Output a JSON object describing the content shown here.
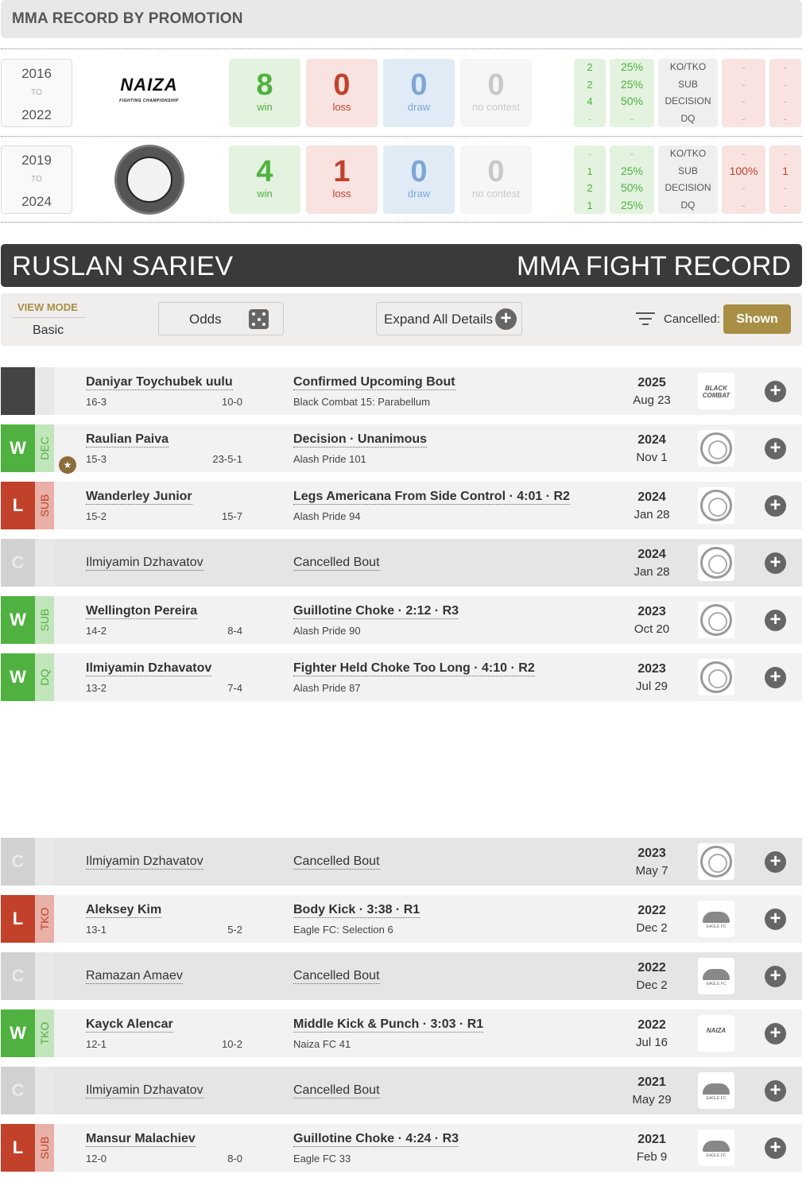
{
  "promotion_section": {
    "title": "MMA RECORD BY PROMOTION"
  },
  "promotions": [
    {
      "start": "2016",
      "to": "TO",
      "end": "2022",
      "logo": "naiza-fighting-championship-logo",
      "logo_text": "NAIZA",
      "logo_sub": "FIGHTING CHAMPIONSHIP",
      "win": "8",
      "loss": "0",
      "draw": "0",
      "nc": "0",
      "win_label": "win",
      "loss_label": "loss",
      "draw_label": "draw",
      "nc_label": "no contest",
      "methods": [
        {
          "count": "2",
          "pct": "25%",
          "name": "KO/TKO",
          "loss_pct": "-",
          "loss_count": "-"
        },
        {
          "count": "2",
          "pct": "25%",
          "name": "SUB",
          "loss_pct": "-",
          "loss_count": "-"
        },
        {
          "count": "4",
          "pct": "50%",
          "name": "DECISION",
          "loss_pct": "-",
          "loss_count": "-"
        },
        {
          "count": "-",
          "pct": "-",
          "name": "DQ",
          "loss_pct": "-",
          "loss_count": "-"
        }
      ]
    },
    {
      "start": "2019",
      "to": "TO",
      "end": "2024",
      "logo": "alash-pride-lion-logo",
      "win": "4",
      "loss": "1",
      "draw": "0",
      "nc": "0",
      "win_label": "win",
      "loss_label": "loss",
      "draw_label": "draw",
      "nc_label": "no contest",
      "methods": [
        {
          "count": "-",
          "pct": "-",
          "name": "KO/TKO",
          "loss_pct": "-",
          "loss_count": "-"
        },
        {
          "count": "1",
          "pct": "25%",
          "name": "SUB",
          "loss_pct": "100%",
          "loss_count": "1"
        },
        {
          "count": "2",
          "pct": "50%",
          "name": "DECISION",
          "loss_pct": "-",
          "loss_count": "-"
        },
        {
          "count": "1",
          "pct": "25%",
          "name": "DQ",
          "loss_pct": "-",
          "loss_count": "-"
        }
      ]
    }
  ],
  "fighter": {
    "name": "RUSLAN SARIEV",
    "title": "MMA FIGHT RECORD"
  },
  "controls": {
    "view_mode_label": "VIEW MODE",
    "view_mode_value": "Basic",
    "odds_label": "Odds",
    "expand_label": "Expand All Details",
    "cancelled_label": "Cancelled:",
    "shown_label": "Shown"
  },
  "colors": {
    "win": "#4fb13f",
    "loss": "#c2412b",
    "draw": "#7da6d6",
    "accent": "#a88f45",
    "dark_bar": "#3a3a3a"
  },
  "fights": [
    {
      "result": "",
      "method": "",
      "opponent": "Daniyar Toychubek uulu",
      "opp_record": "16-3",
      "fighter_record": "10-0",
      "event_title": "Confirmed Upcoming Bout",
      "event": "Black Combat 15: Parabellum",
      "year": "2025",
      "date": "Aug 23",
      "logo": "black-combat-logo",
      "logo_text": "BLACK COMBAT"
    },
    {
      "result": "W",
      "method": "DEC",
      "opponent": "Raulian Paiva",
      "opp_record": "15-3",
      "fighter_record": "23-5-1",
      "event_title": "Decision · Unanimous",
      "event": "Alash Pride 101",
      "year": "2024",
      "date": "Nov 1",
      "logo": "alash-pride-logo"
    },
    {
      "result": "L",
      "method": "SUB",
      "opponent": "Wanderley Junior",
      "opp_record": "15-2",
      "fighter_record": "15-7",
      "event_title": "Legs Americana From Side Control · 4:01 · R2",
      "event": "Alash Pride 94",
      "year": "2024",
      "date": "Jan 28",
      "logo": "alash-pride-logo"
    },
    {
      "result": "C",
      "method": "",
      "opponent": "Ilmiyamin Dzhavatov",
      "opp_record": "",
      "fighter_record": "",
      "event_title": "Cancelled Bout",
      "event": "",
      "year": "2024",
      "date": "Jan 28",
      "logo": "alash-pride-logo"
    },
    {
      "result": "W",
      "method": "SUB",
      "opponent": "Wellington Pereira",
      "opp_record": "14-2",
      "fighter_record": "8-4",
      "event_title": "Guillotine Choke · 2:12 · R3",
      "event": "Alash Pride 90",
      "year": "2023",
      "date": "Oct 20",
      "logo": "alash-pride-logo"
    },
    {
      "result": "W",
      "method": "DQ",
      "opponent": "Ilmiyamin Dzhavatov",
      "opp_record": "13-2",
      "fighter_record": "7-4",
      "event_title": "Fighter Held Choke Too Long · 4:10 · R2",
      "event": "Alash Pride 87",
      "year": "2023",
      "date": "Jul 29",
      "logo": "alash-pride-logo"
    },
    {
      "result": "C",
      "method": "",
      "opponent": "Ilmiyamin Dzhavatov",
      "opp_record": "",
      "fighter_record": "",
      "event_title": "Cancelled Bout",
      "event": "",
      "year": "2023",
      "date": "May 7",
      "logo": "alash-pride-logo"
    },
    {
      "result": "L",
      "method": "TKO",
      "opponent": "Aleksey Kim",
      "opp_record": "13-1",
      "fighter_record": "5-2",
      "event_title": "Body Kick · 3:38 · R1",
      "event": "Eagle FC: Selection 6",
      "year": "2022",
      "date": "Dec 2",
      "logo": "eagle-fc-logo",
      "logo_text": "EAGLE FC"
    },
    {
      "result": "C",
      "method": "",
      "opponent": "Ramazan Amaev",
      "opp_record": "",
      "fighter_record": "",
      "event_title": "Cancelled Bout",
      "event": "",
      "year": "2022",
      "date": "Dec 2",
      "logo": "eagle-fc-logo",
      "logo_text": "EAGLE FC"
    },
    {
      "result": "W",
      "method": "TKO",
      "opponent": "Kayck Alencar",
      "opp_record": "12-1",
      "fighter_record": "10-2",
      "event_title": "Middle Kick & Punch · 3:03 · R1",
      "event": "Naiza FC 41",
      "year": "2022",
      "date": "Jul 16",
      "logo": "naiza-logo",
      "logo_text": "NAIZA"
    },
    {
      "result": "C",
      "method": "",
      "opponent": "Ilmiyamin Dzhavatov",
      "opp_record": "",
      "fighter_record": "",
      "event_title": "Cancelled Bout",
      "event": "",
      "year": "2021",
      "date": "May 29",
      "logo": "eagle-fc-logo",
      "logo_text": "EAGLE FC"
    },
    {
      "result": "L",
      "method": "SUB",
      "opponent": "Mansur Malachiev",
      "opp_record": "12-0",
      "fighter_record": "8-0",
      "event_title": "Guillotine Choke · 4:24 · R3",
      "event": "Eagle FC 33",
      "year": "2021",
      "date": "Feb 9",
      "logo": "eagle-fc-logo",
      "logo_text": "EAGLE FC"
    }
  ]
}
